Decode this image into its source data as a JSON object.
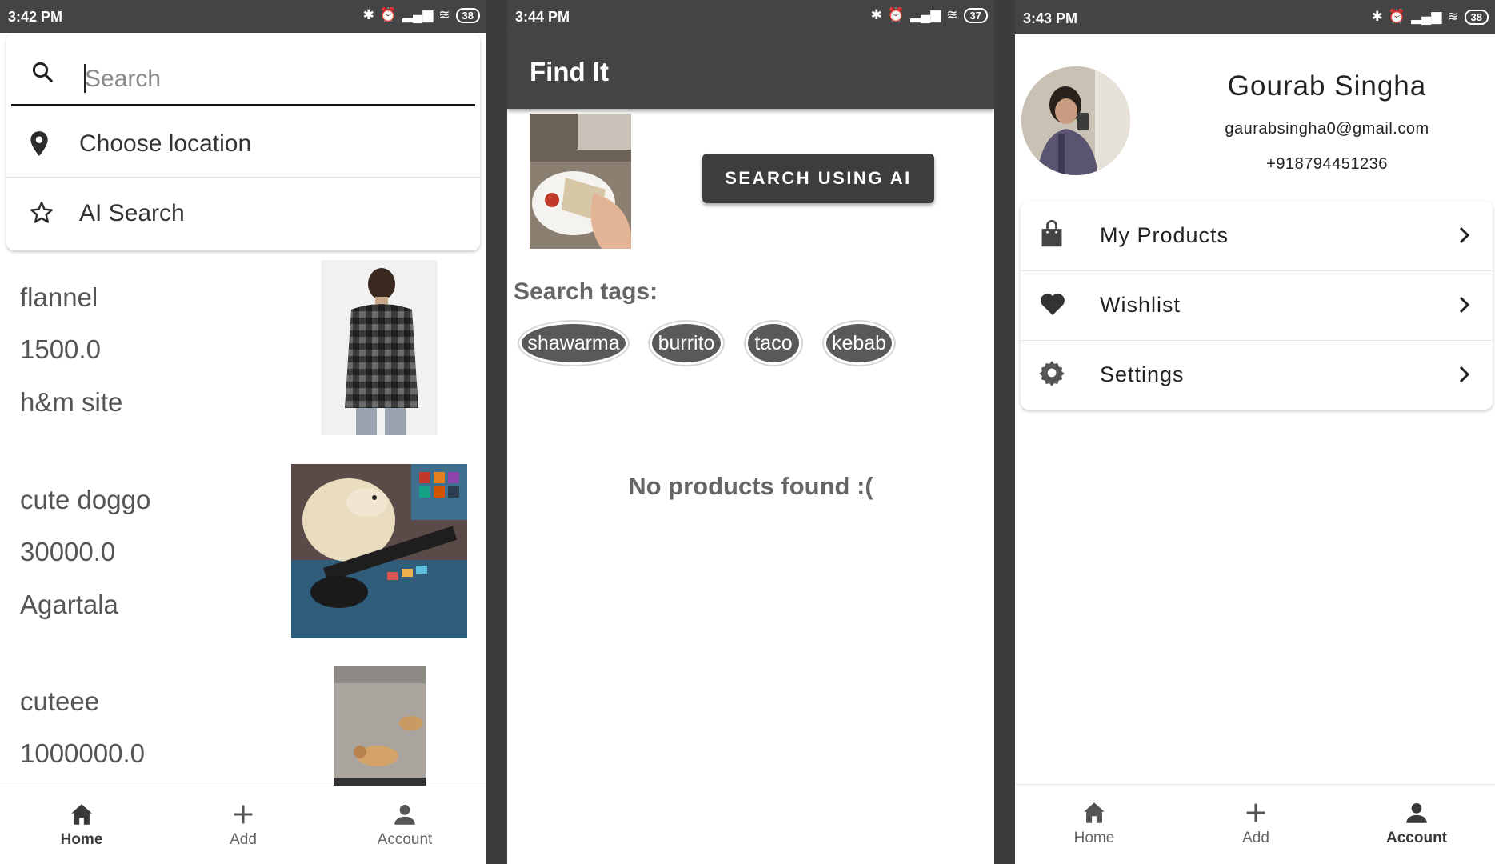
{
  "screens": {
    "home": {
      "status": {
        "time": "3:42 PM",
        "battery": "38"
      },
      "search": {
        "placeholder": "Search"
      },
      "options": [
        {
          "label": "Choose location",
          "icon": "location-pin-icon"
        },
        {
          "label": "AI Search",
          "icon": "star-icon"
        }
      ],
      "products": [
        {
          "name": "flannel",
          "price": "1500.0",
          "location": "h&m site"
        },
        {
          "name": "cute doggo",
          "price": "30000.0",
          "location": "Agartala"
        },
        {
          "name": "cuteee",
          "price": "1000000.0",
          "location": ""
        }
      ],
      "nav": {
        "home": "Home",
        "add": "Add",
        "account": "Account",
        "active": "Home"
      }
    },
    "ai_search": {
      "status": {
        "time": "3:44 PM",
        "battery": "37"
      },
      "app_title": "Find It",
      "button_label": "SEARCH USING AI",
      "tags_title": "Search tags:",
      "tags": [
        "shawarma",
        "burrito",
        "taco",
        "kebab"
      ],
      "empty_message": "No products found  :("
    },
    "account": {
      "status": {
        "time": "3:43 PM",
        "battery": "38"
      },
      "name": "Gourab Singha",
      "email": "gaurabsingha0@gmail.com",
      "phone": "+918794451236",
      "menu": [
        {
          "label": "My Products",
          "icon": "shopping-bag-icon"
        },
        {
          "label": "Wishlist",
          "icon": "heart-icon"
        },
        {
          "label": "Settings",
          "icon": "gear-icon"
        }
      ],
      "nav": {
        "home": "Home",
        "add": "Add",
        "account": "Account",
        "active": "Account"
      }
    }
  },
  "colors": {
    "dark": "#444444",
    "chip": "#595959",
    "text_muted": "#666666"
  }
}
